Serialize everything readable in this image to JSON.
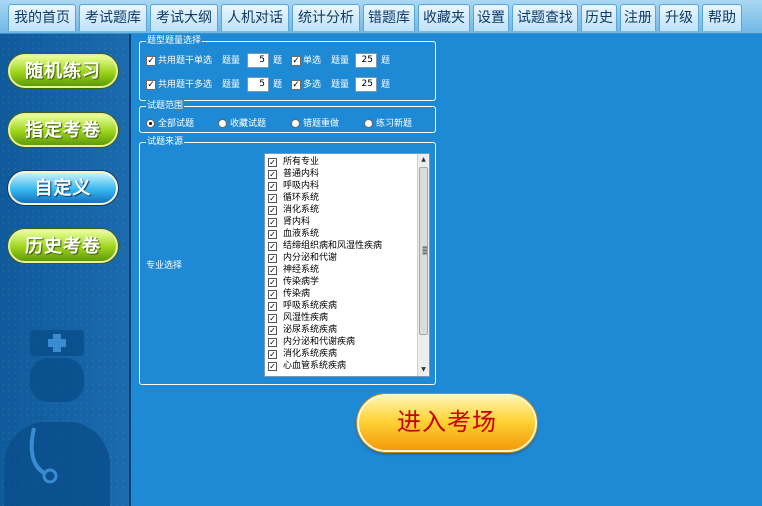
{
  "tabs": [
    "我的首页",
    "考试题库",
    "考试大纲",
    "人机对话",
    "统计分析",
    "错题库",
    "收藏夹",
    "设置",
    "试题查找",
    "历史",
    "注册",
    "升级",
    "帮助"
  ],
  "sidebar": {
    "random_practice": "随机练习",
    "assigned_exam": "指定考卷",
    "custom": "自定义",
    "history_exam": "历史考卷"
  },
  "question_count": {
    "title": "题型题量选择",
    "row1": {
      "shared_stem_label": "共用题干单选",
      "qty_label": "题量",
      "qty_value": "5",
      "unit": "题",
      "type_label": "单选",
      "type_qty_label": "题量",
      "type_qty_value": "25",
      "type_unit": "题"
    },
    "row2": {
      "shared_stem_label": "共用题干多选",
      "qty_label": "题量",
      "qty_value": "5",
      "unit": "题",
      "type_label": "多选",
      "type_qty_label": "题量",
      "type_qty_value": "25",
      "type_unit": "题"
    }
  },
  "scope": {
    "title": "试题范围",
    "options": [
      "全部试题",
      "收藏试题",
      "错题重做",
      "练习新题"
    ],
    "selected": "全部试题"
  },
  "source": {
    "title": "试题来源",
    "specialty_label": "专业选择",
    "items": [
      "所有专业",
      "普通内科",
      "呼吸内科",
      "循环系统",
      "消化系统",
      "肾内科",
      "血液系统",
      "结缔组织病和风湿性疾病",
      "内分泌和代谢",
      "神经系统",
      "传染病学",
      "传染病",
      "呼吸系统疾病",
      "风湿性疾病",
      "泌尿系统疾病",
      "内分泌和代谢疾病",
      "消化系统疾病",
      "心血管系统疾病"
    ]
  },
  "enter_button": "进入考场",
  "check_mark": "✓",
  "scroll_up": "▲",
  "scroll_down": "▼"
}
